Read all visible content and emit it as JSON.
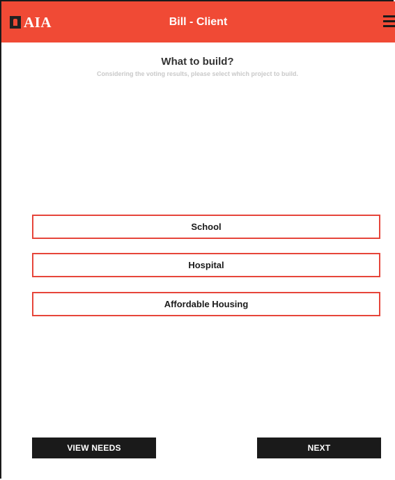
{
  "header": {
    "logo_text": "AIA",
    "logo_icon": "aia-emblem-icon",
    "title": "Bill - Client",
    "menu_icon": "hamburger-menu-icon",
    "background_color": "#f04a35"
  },
  "main": {
    "title": "What to build?",
    "subtitle": "Considering the voting results, please select which project to build.",
    "options": [
      {
        "label": "School"
      },
      {
        "label": "Hospital"
      },
      {
        "label": "Affordable Housing"
      }
    ],
    "option_border_color": "#e6453a"
  },
  "footer": {
    "view_needs_label": "VIEW NEEDS",
    "next_label": "NEXT",
    "button_color": "#1a1a1a"
  }
}
